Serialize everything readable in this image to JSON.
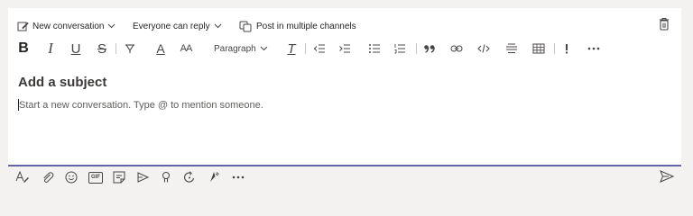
{
  "topbar": {
    "new_conversation": "New conversation",
    "reply_setting": "Everyone can reply",
    "post_multiple": "Post in multiple channels",
    "icons": [
      "edit-icon",
      "chevron-down-icon",
      "post-multiple-icon",
      "trash-icon"
    ]
  },
  "format_toolbar": {
    "bold": "B",
    "italic": "I",
    "underline": "U",
    "strikethrough": "S",
    "font_color": "A",
    "font_size": "AA",
    "paragraph_style": "Paragraph",
    "clear_format": "T",
    "icons": [
      "highlight-icon",
      "decrease-indent-icon",
      "increase-indent-icon",
      "bulleted-list-icon",
      "numbered-list-icon",
      "quote-icon",
      "link-icon",
      "code-snippet-icon",
      "horizontal-rule-icon",
      "table-icon",
      "important-icon",
      "more-options-icon"
    ]
  },
  "compose": {
    "subject_placeholder": "Add a subject",
    "message_placeholder": "Start a new conversation. Type @ to mention someone."
  },
  "bottom_toolbar": {
    "gif_label": "GIF",
    "icons": [
      "format-icon",
      "attach-icon",
      "emoji-icon",
      "gif-icon",
      "sticker-icon",
      "meet-now-icon",
      "praise-icon",
      "loop-icon",
      "apps-icon",
      "more-options-icon",
      "send-icon"
    ]
  },
  "colors": {
    "accent": "#6264a7",
    "text": "#252423",
    "icon": "#484644",
    "background": "#f3f2f1"
  }
}
